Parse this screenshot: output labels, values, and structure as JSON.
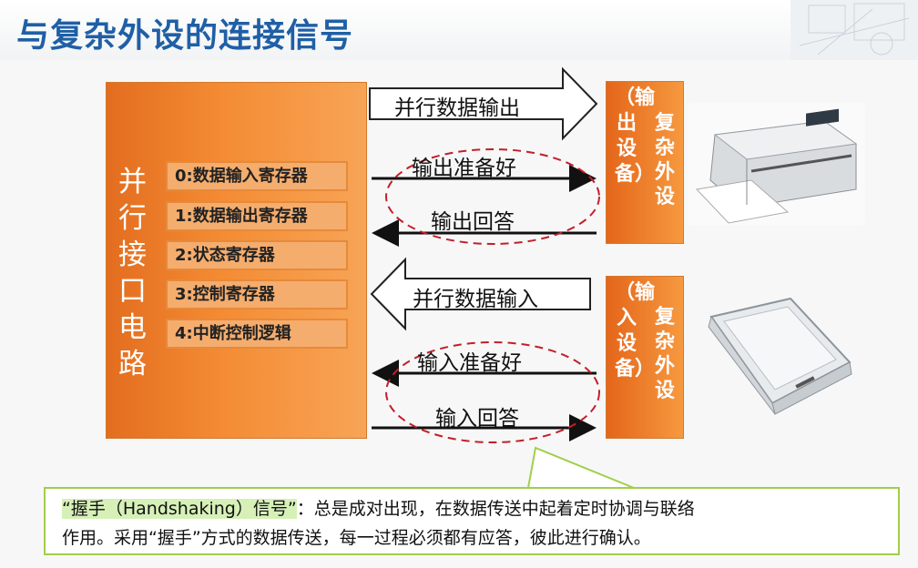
{
  "title": "与复杂外设的连接信号",
  "interface": {
    "label": "并行接口电路",
    "registers": [
      "0:数据输入寄存器",
      "1:数据输出寄存器",
      "2:状态寄存器",
      "3:控制寄存器",
      "4:中断控制逻辑"
    ]
  },
  "signals": {
    "parallel_out": "并行数据输出",
    "out_ready": "输出准备好",
    "out_ack": "输出回答",
    "parallel_in": "并行数据输入",
    "in_ready": "输入准备好",
    "in_ack": "输入回答"
  },
  "devices": {
    "output_name": "复杂外设",
    "output_sub": "（输出设备）",
    "input_name": "复杂外设",
    "input_sub": "（输入设备）"
  },
  "note": {
    "quote": "“握手（Handshaking）信号”",
    "line1_rest": "：总是成对出现，在数据传送中起着定时协调与联络",
    "line2": "作用。采用“握手”方式的数据传送，每一过程必须都有应答，彼此进行确认。"
  }
}
